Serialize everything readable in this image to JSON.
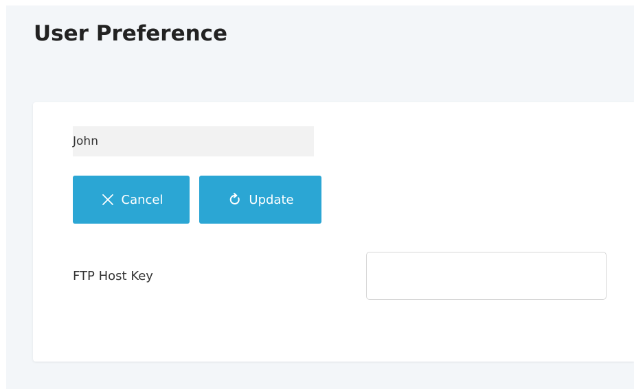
{
  "page": {
    "title": "User Preference"
  },
  "form": {
    "username": "John",
    "cancel_label": "Cancel",
    "update_label": "Update",
    "ftp_host_key": {
      "label": "FTP Host Key",
      "value": "",
      "placeholder": ""
    }
  },
  "icons": {
    "cancel": "close-icon",
    "update": "refresh-icon"
  },
  "colors": {
    "accent": "#2ba6d4",
    "page_background": "#f3f6f9",
    "card_background": "#ffffff",
    "readonly_field": "#f2f2f2"
  }
}
